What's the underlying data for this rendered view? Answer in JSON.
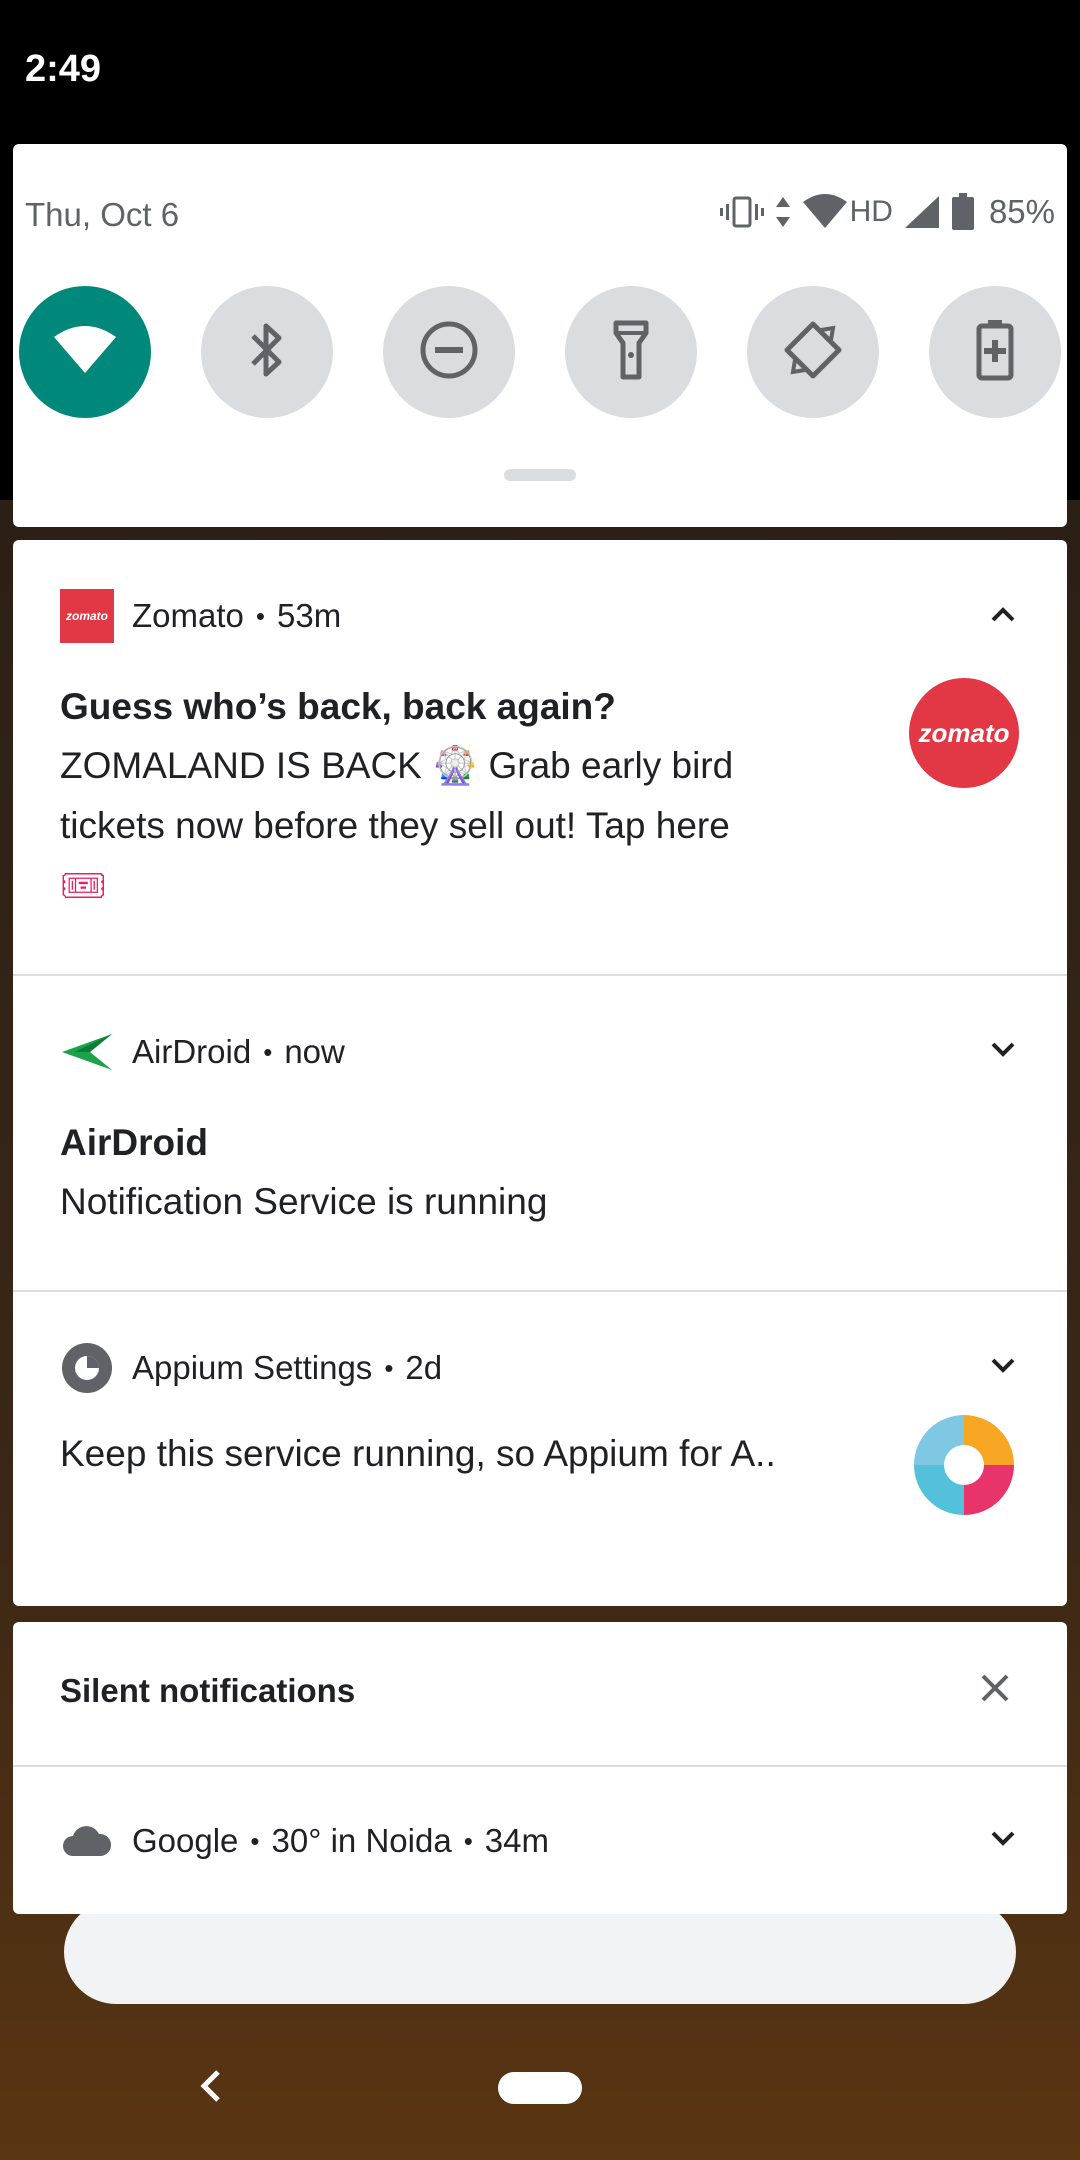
{
  "status_bar": {
    "time": "2:49"
  },
  "quick_settings": {
    "date": "Thu, Oct 6",
    "network_label": "HD",
    "battery_percent": "85%",
    "tiles": [
      {
        "icon": "wifi-icon",
        "active": true
      },
      {
        "icon": "bluetooth-icon",
        "active": false
      },
      {
        "icon": "do-not-disturb-icon",
        "active": false
      },
      {
        "icon": "flashlight-icon",
        "active": false
      },
      {
        "icon": "auto-rotate-icon",
        "active": false
      },
      {
        "icon": "battery-saver-icon",
        "active": false
      }
    ],
    "accent_color": "#00897b"
  },
  "notifications": [
    {
      "app": "Zomato",
      "time": "53m",
      "title": "Guess who’s back, back again?",
      "body_line1": "ZOMALAND IS BACK 🎡 Grab early bird",
      "body_line2": "tickets now before they sell out! Tap here",
      "body_line3": "🎟",
      "app_icon_text": "zomato",
      "large_icon_text": "zomato",
      "expanded": true,
      "brand_color": "#e23744"
    },
    {
      "app": "AirDroid",
      "time": "now",
      "title": "AirDroid",
      "body": "Notification Service is running",
      "expanded": false,
      "brand_color": "#1aa34a"
    },
    {
      "app": "Appium Settings",
      "time": "2d",
      "body": "Keep this service running, so Appium for A..",
      "expanded": false
    }
  ],
  "silent_section": {
    "title": "Silent notifications",
    "items": [
      {
        "app": "Google",
        "summary": "30° in Noida",
        "time": "34m",
        "icon": "cloud-icon"
      }
    ]
  },
  "dot": "•"
}
